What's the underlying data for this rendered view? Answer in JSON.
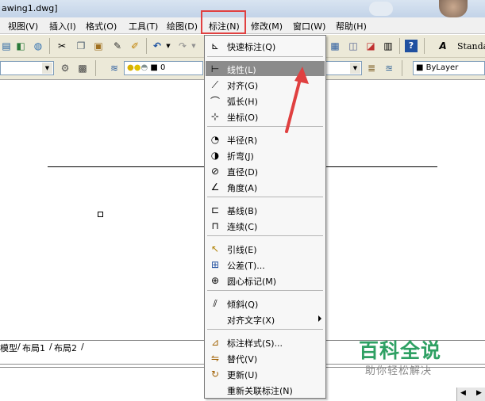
{
  "window": {
    "title": "awing1.dwg]"
  },
  "menubar": {
    "items": [
      "视图(V)",
      "插入(I)",
      "格式(O)",
      "工具(T)",
      "绘图(D)",
      "标注(N)",
      "修改(M)",
      "窗口(W)",
      "帮助(H)"
    ],
    "active": "标注(N)"
  },
  "toolbar": {
    "text_style": "Standa",
    "layer_value": "0",
    "linetype_value": "ByLayer"
  },
  "dimension_menu": {
    "items": [
      {
        "label": "快速标注(Q)",
        "icon": "quick-dimension-icon"
      },
      {
        "label": "线性(L)",
        "icon": "linear-dimension-icon",
        "selected": true
      },
      {
        "label": "对齐(G)",
        "icon": "aligned-dimension-icon"
      },
      {
        "label": "弧长(H)",
        "icon": "arc-length-icon"
      },
      {
        "label": "坐标(O)",
        "icon": "ordinate-icon"
      },
      {
        "label": "半径(R)",
        "icon": "radius-icon"
      },
      {
        "label": "折弯(J)",
        "icon": "jogged-icon"
      },
      {
        "label": "直径(D)",
        "icon": "diameter-icon"
      },
      {
        "label": "角度(A)",
        "icon": "angular-icon"
      },
      {
        "label": "基线(B)",
        "icon": "baseline-icon"
      },
      {
        "label": "连续(C)",
        "icon": "continue-icon"
      },
      {
        "label": "引线(E)",
        "icon": "leader-icon"
      },
      {
        "label": "公差(T)...",
        "icon": "tolerance-icon"
      },
      {
        "label": "圆心标记(M)",
        "icon": "center-mark-icon"
      },
      {
        "label": "倾斜(Q)",
        "icon": "oblique-icon"
      },
      {
        "label": "对齐文字(X)",
        "icon": "",
        "submenu": true
      },
      {
        "label": "标注样式(S)...",
        "icon": "dimension-style-icon"
      },
      {
        "label": "替代(V)",
        "icon": "override-icon"
      },
      {
        "label": "更新(U)",
        "icon": "update-icon"
      },
      {
        "label": "重新关联标注(N)",
        "icon": ""
      }
    ]
  },
  "layout_tabs": [
    "模型",
    "布局1",
    "布局2"
  ],
  "watermark": {
    "logo": "百科全说",
    "slogan": "助你轻松解决"
  },
  "colors": {
    "highlight_box": "#e04040",
    "selected_item": "#8b8b8b",
    "watermark_green": "#2ea063",
    "toolbar_bg": "#ece9d8"
  }
}
